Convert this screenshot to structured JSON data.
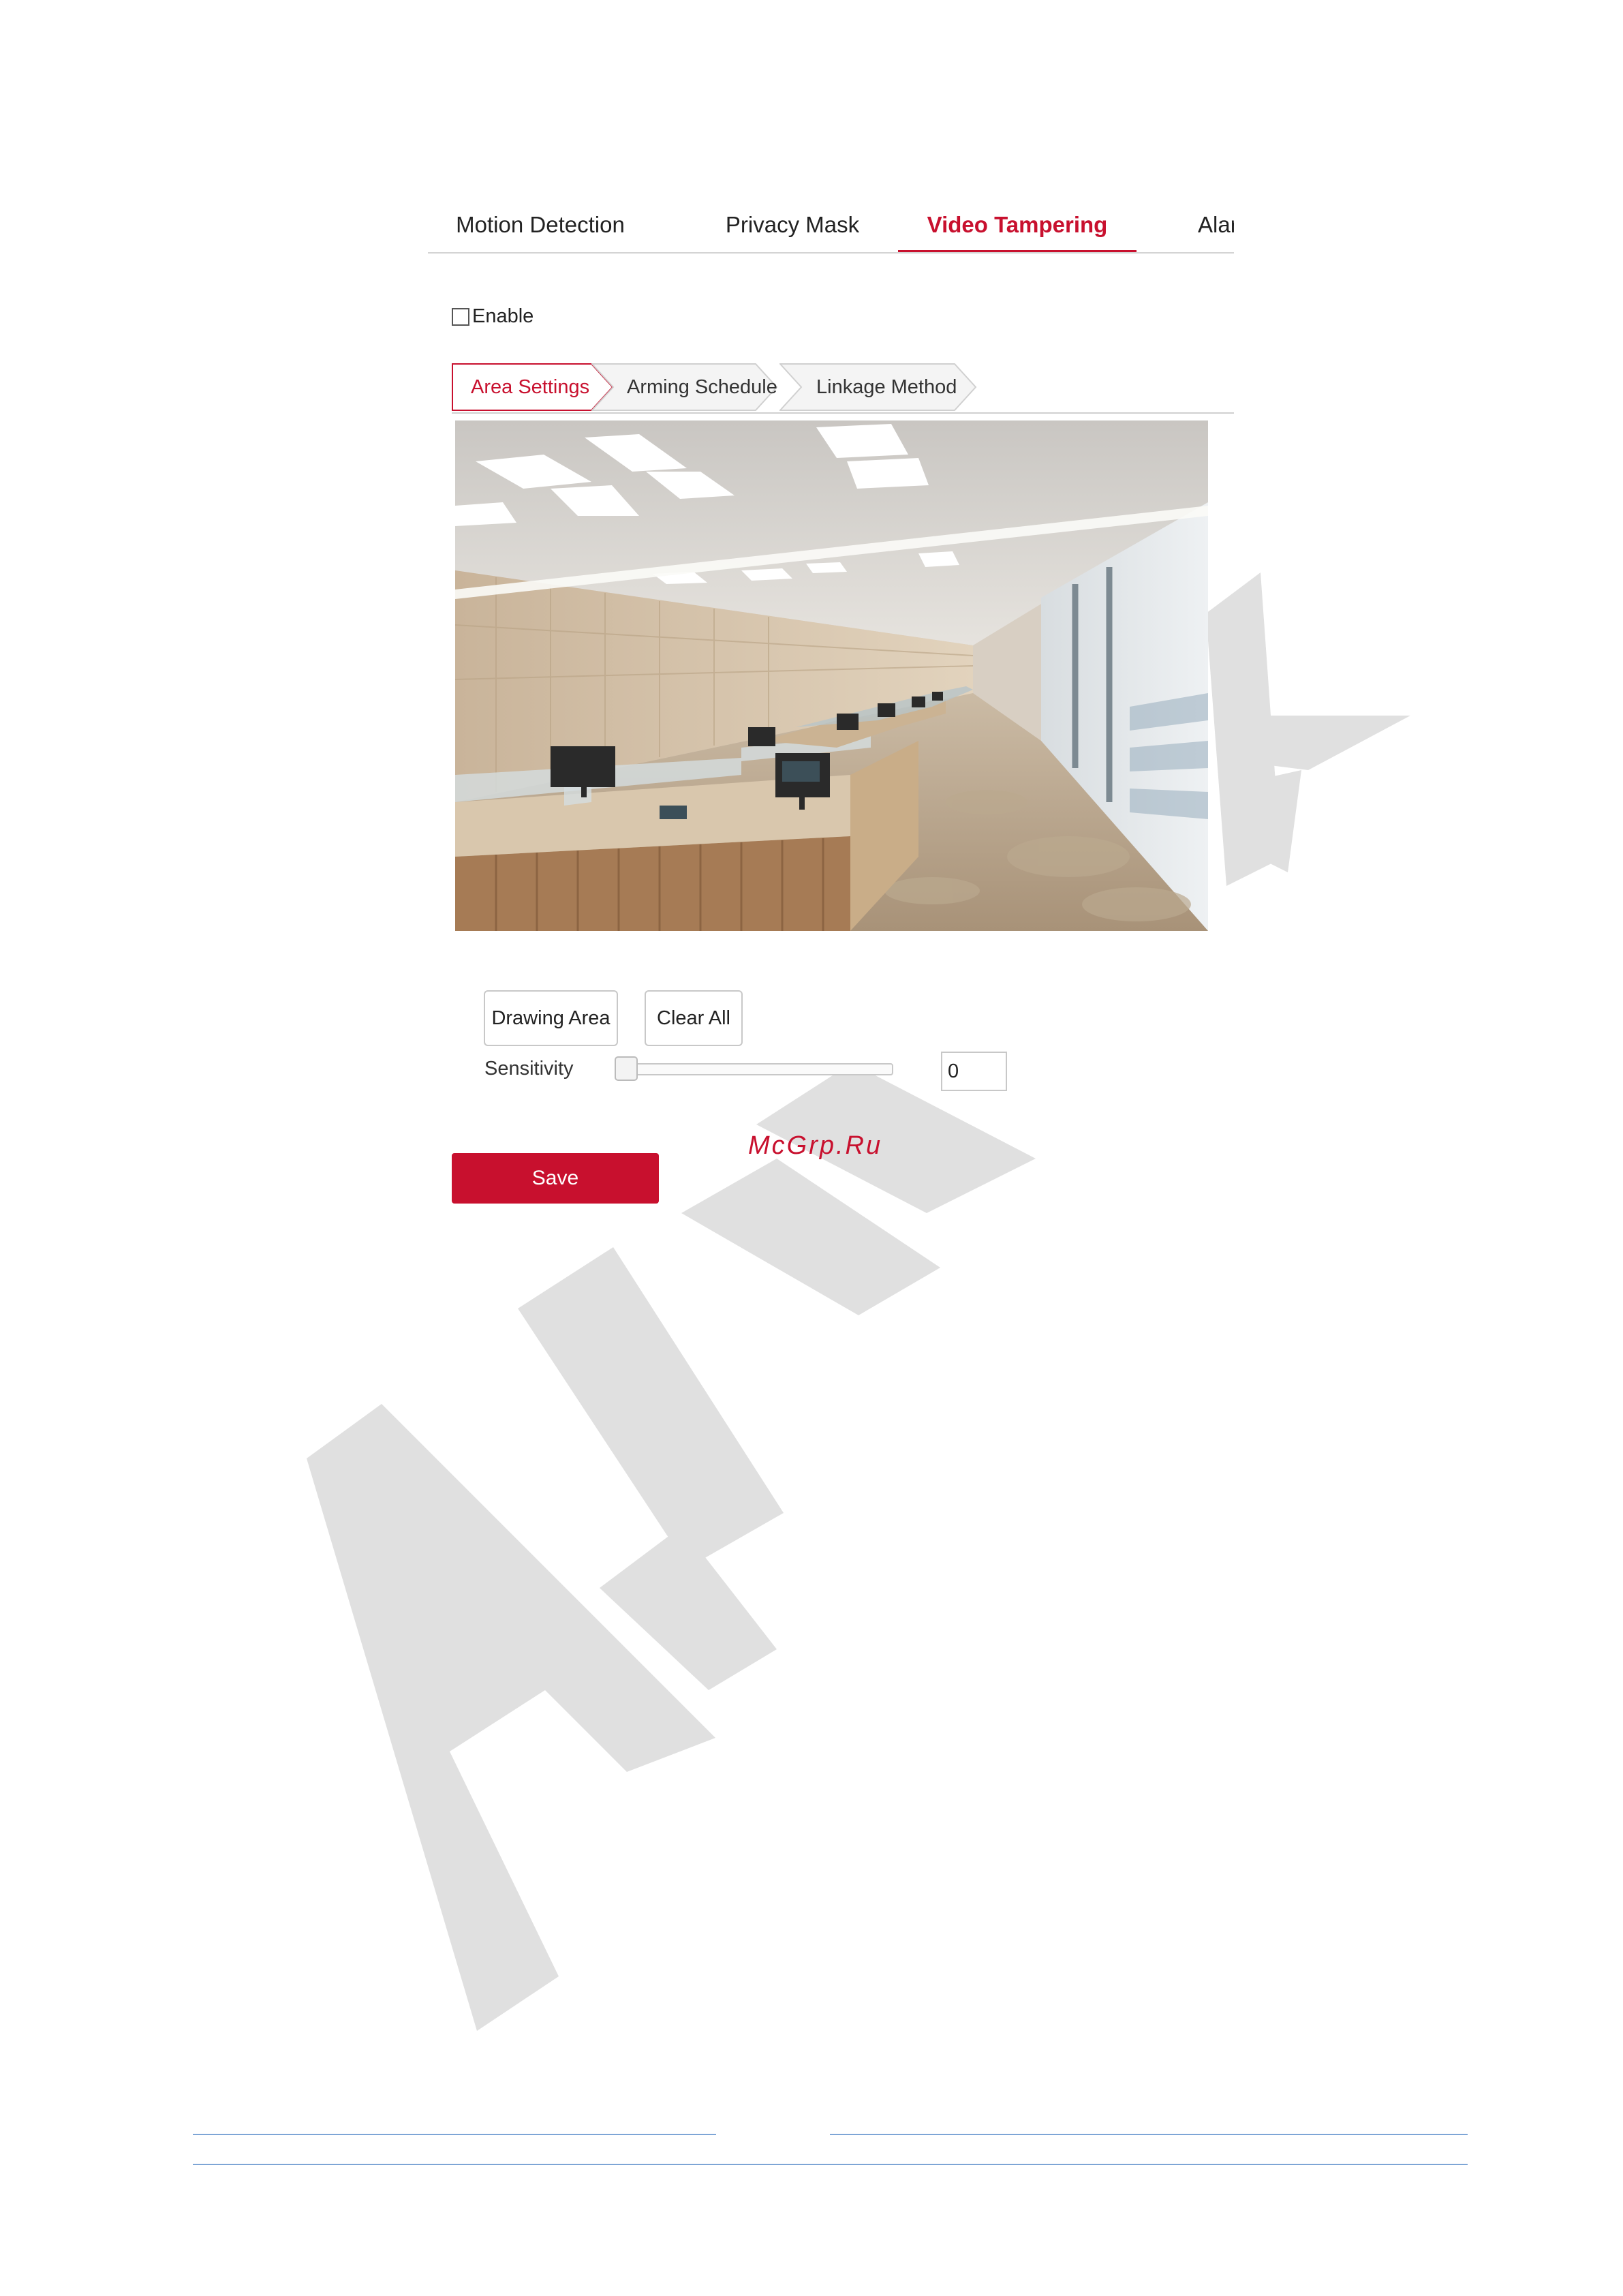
{
  "tabs": [
    {
      "label": "Motion Detection",
      "active": false
    },
    {
      "label": "Privacy Mask",
      "active": false
    },
    {
      "label": "Video Tampering",
      "active": true
    },
    {
      "label": "Alarm",
      "active": false
    }
  ],
  "enable": {
    "label": "Enable",
    "checked": false
  },
  "subtabs": [
    {
      "label": "Area Settings",
      "active": true
    },
    {
      "label": "Arming Schedule",
      "active": false
    },
    {
      "label": "Linkage Method",
      "active": false
    }
  ],
  "controls": {
    "drawing_area_label": "Drawing Area",
    "clear_all_label": "Clear All",
    "sensitivity_label": "Sensitivity",
    "sensitivity_value": "0",
    "save_label": "Save"
  },
  "brand_text": "McGrp.Ru",
  "colors": {
    "accent": "#c8102e",
    "watermark": "#e0e0e0",
    "footer_line": "#7ea6d6"
  },
  "icons": {
    "checkbox": "checkbox-unchecked-icon",
    "slider": "slider-thumb-icon"
  }
}
